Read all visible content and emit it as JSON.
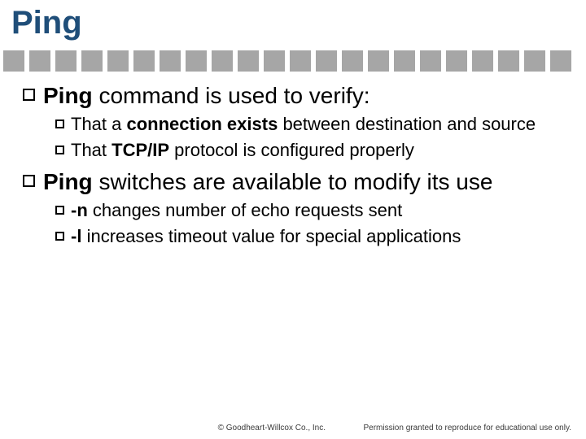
{
  "title": "Ping",
  "bullets": {
    "b1_pre": "Ping",
    "b1_post": " command is used to verify:",
    "b1a_pre": "That a ",
    "b1a_bold": "connection exists",
    "b1a_post": " between destination and source",
    "b1b_pre": "That ",
    "b1b_bold": "TCP/IP",
    "b1b_post": " protocol is configured properly",
    "b2_pre": "Ping",
    "b2_post": " switches are available to modify its use",
    "b2a_bold": "-n",
    "b2a_post": " changes number of echo requests sent",
    "b2b_bold": "-l",
    "b2b_post": " increases timeout value for special applications"
  },
  "footer": {
    "copyright": "© Goodheart-Willcox Co., Inc.",
    "permission": "Permission granted to reproduce for educational use only."
  }
}
